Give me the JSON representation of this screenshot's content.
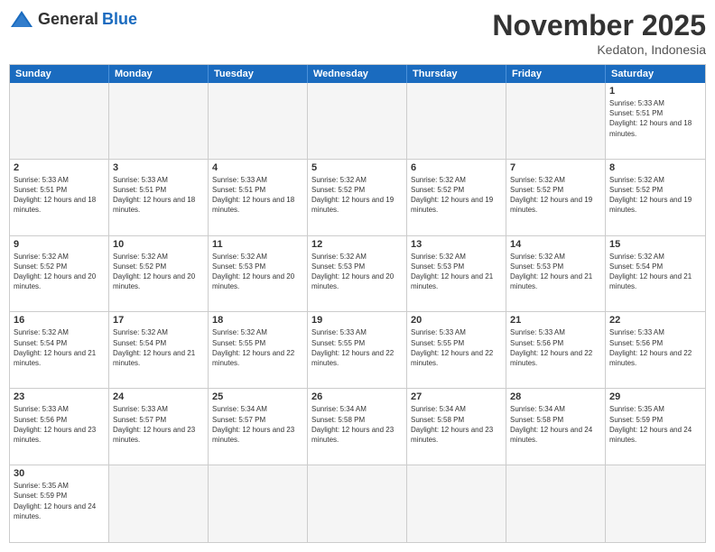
{
  "logo": {
    "general": "General",
    "blue": "Blue"
  },
  "header": {
    "title": "November 2025",
    "location": "Kedaton, Indonesia"
  },
  "days": [
    "Sunday",
    "Monday",
    "Tuesday",
    "Wednesday",
    "Thursday",
    "Friday",
    "Saturday"
  ],
  "cells": [
    {
      "day": null,
      "empty": true
    },
    {
      "day": null,
      "empty": true
    },
    {
      "day": null,
      "empty": true
    },
    {
      "day": null,
      "empty": true
    },
    {
      "day": null,
      "empty": true
    },
    {
      "day": null,
      "empty": true
    },
    {
      "day": "1",
      "sunrise": "Sunrise: 5:33 AM",
      "sunset": "Sunset: 5:51 PM",
      "daylight": "Daylight: 12 hours and 18 minutes."
    },
    {
      "day": "2",
      "sunrise": "Sunrise: 5:33 AM",
      "sunset": "Sunset: 5:51 PM",
      "daylight": "Daylight: 12 hours and 18 minutes."
    },
    {
      "day": "3",
      "sunrise": "Sunrise: 5:33 AM",
      "sunset": "Sunset: 5:51 PM",
      "daylight": "Daylight: 12 hours and 18 minutes."
    },
    {
      "day": "4",
      "sunrise": "Sunrise: 5:33 AM",
      "sunset": "Sunset: 5:51 PM",
      "daylight": "Daylight: 12 hours and 18 minutes."
    },
    {
      "day": "5",
      "sunrise": "Sunrise: 5:32 AM",
      "sunset": "Sunset: 5:52 PM",
      "daylight": "Daylight: 12 hours and 19 minutes."
    },
    {
      "day": "6",
      "sunrise": "Sunrise: 5:32 AM",
      "sunset": "Sunset: 5:52 PM",
      "daylight": "Daylight: 12 hours and 19 minutes."
    },
    {
      "day": "7",
      "sunrise": "Sunrise: 5:32 AM",
      "sunset": "Sunset: 5:52 PM",
      "daylight": "Daylight: 12 hours and 19 minutes."
    },
    {
      "day": "8",
      "sunrise": "Sunrise: 5:32 AM",
      "sunset": "Sunset: 5:52 PM",
      "daylight": "Daylight: 12 hours and 19 minutes."
    },
    {
      "day": "9",
      "sunrise": "Sunrise: 5:32 AM",
      "sunset": "Sunset: 5:52 PM",
      "daylight": "Daylight: 12 hours and 20 minutes."
    },
    {
      "day": "10",
      "sunrise": "Sunrise: 5:32 AM",
      "sunset": "Sunset: 5:52 PM",
      "daylight": "Daylight: 12 hours and 20 minutes."
    },
    {
      "day": "11",
      "sunrise": "Sunrise: 5:32 AM",
      "sunset": "Sunset: 5:53 PM",
      "daylight": "Daylight: 12 hours and 20 minutes."
    },
    {
      "day": "12",
      "sunrise": "Sunrise: 5:32 AM",
      "sunset": "Sunset: 5:53 PM",
      "daylight": "Daylight: 12 hours and 20 minutes."
    },
    {
      "day": "13",
      "sunrise": "Sunrise: 5:32 AM",
      "sunset": "Sunset: 5:53 PM",
      "daylight": "Daylight: 12 hours and 21 minutes."
    },
    {
      "day": "14",
      "sunrise": "Sunrise: 5:32 AM",
      "sunset": "Sunset: 5:53 PM",
      "daylight": "Daylight: 12 hours and 21 minutes."
    },
    {
      "day": "15",
      "sunrise": "Sunrise: 5:32 AM",
      "sunset": "Sunset: 5:54 PM",
      "daylight": "Daylight: 12 hours and 21 minutes."
    },
    {
      "day": "16",
      "sunrise": "Sunrise: 5:32 AM",
      "sunset": "Sunset: 5:54 PM",
      "daylight": "Daylight: 12 hours and 21 minutes."
    },
    {
      "day": "17",
      "sunrise": "Sunrise: 5:32 AM",
      "sunset": "Sunset: 5:54 PM",
      "daylight": "Daylight: 12 hours and 21 minutes."
    },
    {
      "day": "18",
      "sunrise": "Sunrise: 5:32 AM",
      "sunset": "Sunset: 5:55 PM",
      "daylight": "Daylight: 12 hours and 22 minutes."
    },
    {
      "day": "19",
      "sunrise": "Sunrise: 5:33 AM",
      "sunset": "Sunset: 5:55 PM",
      "daylight": "Daylight: 12 hours and 22 minutes."
    },
    {
      "day": "20",
      "sunrise": "Sunrise: 5:33 AM",
      "sunset": "Sunset: 5:55 PM",
      "daylight": "Daylight: 12 hours and 22 minutes."
    },
    {
      "day": "21",
      "sunrise": "Sunrise: 5:33 AM",
      "sunset": "Sunset: 5:56 PM",
      "daylight": "Daylight: 12 hours and 22 minutes."
    },
    {
      "day": "22",
      "sunrise": "Sunrise: 5:33 AM",
      "sunset": "Sunset: 5:56 PM",
      "daylight": "Daylight: 12 hours and 22 minutes."
    },
    {
      "day": "23",
      "sunrise": "Sunrise: 5:33 AM",
      "sunset": "Sunset: 5:56 PM",
      "daylight": "Daylight: 12 hours and 23 minutes."
    },
    {
      "day": "24",
      "sunrise": "Sunrise: 5:33 AM",
      "sunset": "Sunset: 5:57 PM",
      "daylight": "Daylight: 12 hours and 23 minutes."
    },
    {
      "day": "25",
      "sunrise": "Sunrise: 5:34 AM",
      "sunset": "Sunset: 5:57 PM",
      "daylight": "Daylight: 12 hours and 23 minutes."
    },
    {
      "day": "26",
      "sunrise": "Sunrise: 5:34 AM",
      "sunset": "Sunset: 5:58 PM",
      "daylight": "Daylight: 12 hours and 23 minutes."
    },
    {
      "day": "27",
      "sunrise": "Sunrise: 5:34 AM",
      "sunset": "Sunset: 5:58 PM",
      "daylight": "Daylight: 12 hours and 23 minutes."
    },
    {
      "day": "28",
      "sunrise": "Sunrise: 5:34 AM",
      "sunset": "Sunset: 5:58 PM",
      "daylight": "Daylight: 12 hours and 24 minutes."
    },
    {
      "day": "29",
      "sunrise": "Sunrise: 5:35 AM",
      "sunset": "Sunset: 5:59 PM",
      "daylight": "Daylight: 12 hours and 24 minutes."
    },
    {
      "day": "30",
      "sunrise": "Sunrise: 5:35 AM",
      "sunset": "Sunset: 5:59 PM",
      "daylight": "Daylight: 12 hours and 24 minutes."
    },
    {
      "day": null,
      "empty": true
    },
    {
      "day": null,
      "empty": true
    },
    {
      "day": null,
      "empty": true
    },
    {
      "day": null,
      "empty": true
    },
    {
      "day": null,
      "empty": true
    },
    {
      "day": null,
      "empty": true
    }
  ]
}
